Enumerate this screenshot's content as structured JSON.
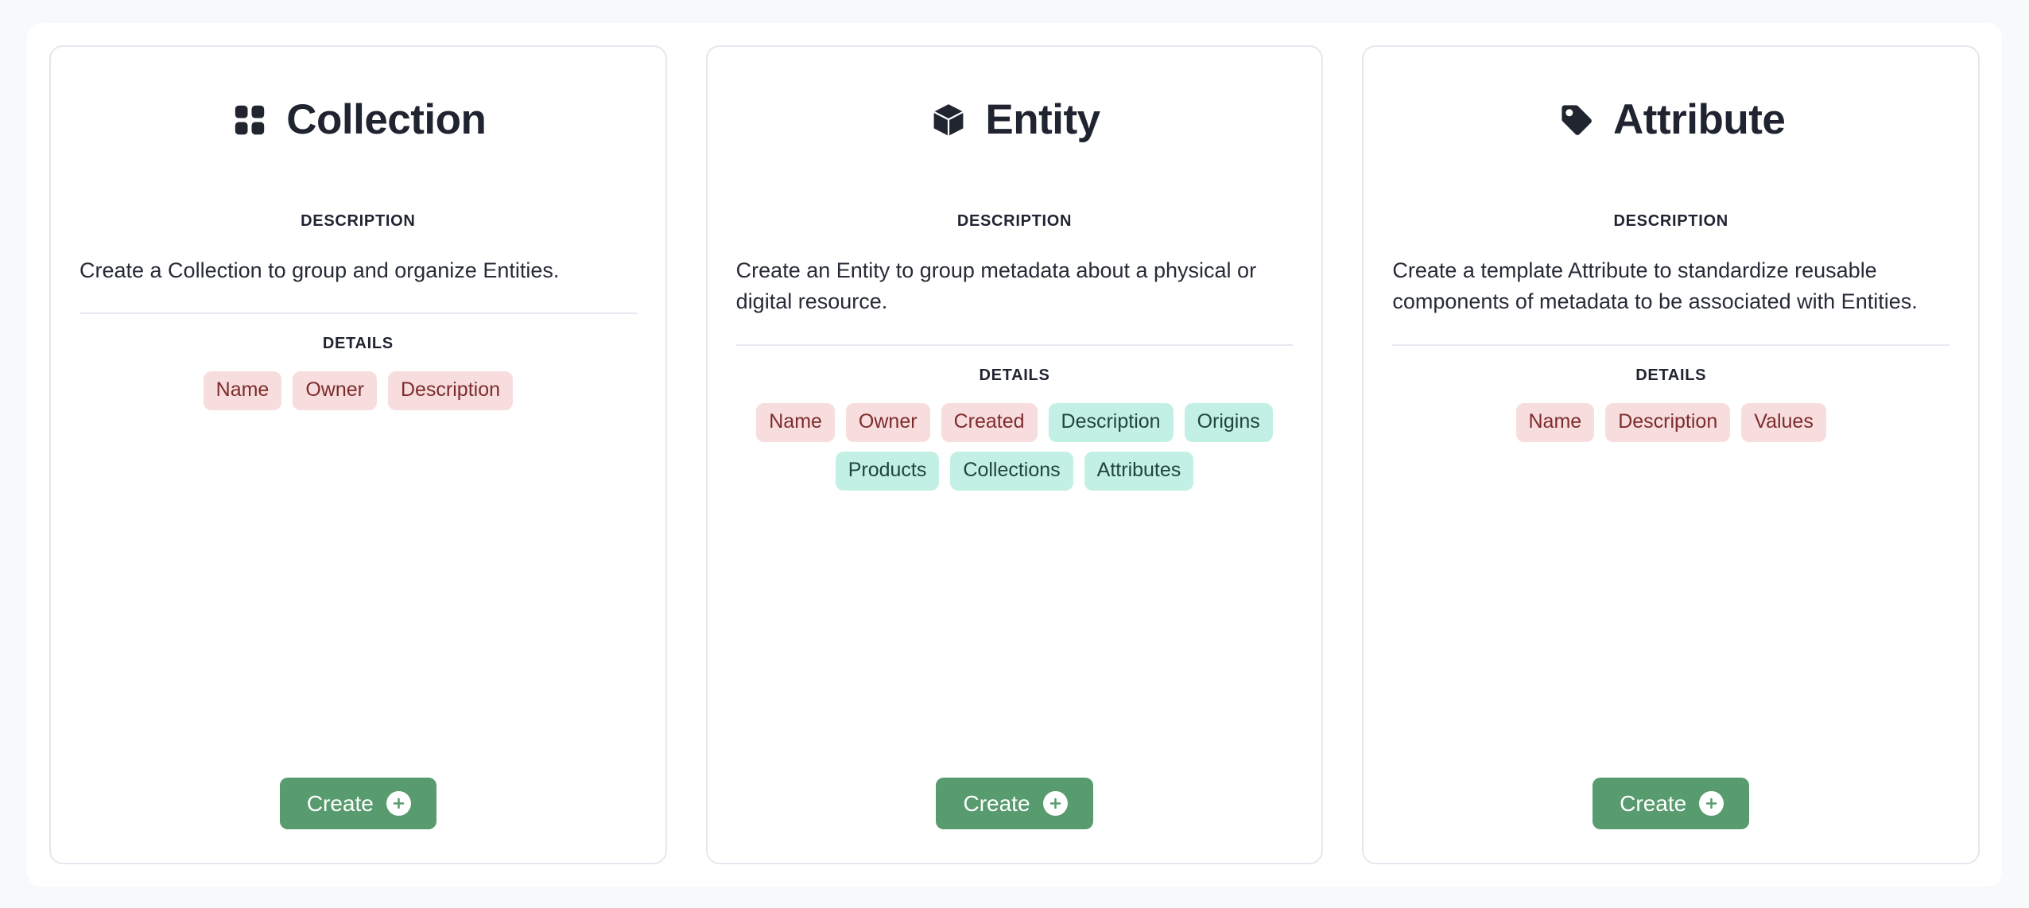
{
  "theme": {
    "page_background": "#f7f9fb",
    "panel_background": "#ffffff",
    "card_border": "#e3e8ee",
    "title_color": "#1f2430",
    "required_tag_bg": "#f7dddd",
    "required_tag_text": "#7e2b2b",
    "optional_tag_bg": "#c3f0e4",
    "optional_tag_text": "#20443e",
    "create_button_bg": "#579b6f",
    "create_button_text": "#ffffff"
  },
  "cards": [
    {
      "id": "collection",
      "icon": "grid-icon",
      "title": "Collection",
      "description_label": "DESCRIPTION",
      "description": "Create a Collection to group and organize Entities.",
      "details_label": "DETAILS",
      "tags": [
        {
          "label": "Name",
          "kind": "required"
        },
        {
          "label": "Owner",
          "kind": "required"
        },
        {
          "label": "Description",
          "kind": "required"
        }
      ],
      "create_label": "Create"
    },
    {
      "id": "entity",
      "icon": "cube-icon",
      "title": "Entity",
      "description_label": "DESCRIPTION",
      "description": "Create an Entity to group metadata about a physical or digital resource.",
      "details_label": "DETAILS",
      "tags": [
        {
          "label": "Name",
          "kind": "required"
        },
        {
          "label": "Owner",
          "kind": "required"
        },
        {
          "label": "Created",
          "kind": "required"
        },
        {
          "label": "Description",
          "kind": "optional"
        },
        {
          "label": "Origins",
          "kind": "optional"
        },
        {
          "label": "Products",
          "kind": "optional"
        },
        {
          "label": "Collections",
          "kind": "optional"
        },
        {
          "label": "Attributes",
          "kind": "optional"
        }
      ],
      "create_label": "Create"
    },
    {
      "id": "attribute",
      "icon": "tag-icon",
      "title": "Attribute",
      "description_label": "DESCRIPTION",
      "description": "Create a template Attribute to standardize reusable components of metadata to be associated with Entities.",
      "details_label": "DETAILS",
      "tags": [
        {
          "label": "Name",
          "kind": "required"
        },
        {
          "label": "Description",
          "kind": "required"
        },
        {
          "label": "Values",
          "kind": "required"
        }
      ],
      "create_label": "Create"
    }
  ]
}
